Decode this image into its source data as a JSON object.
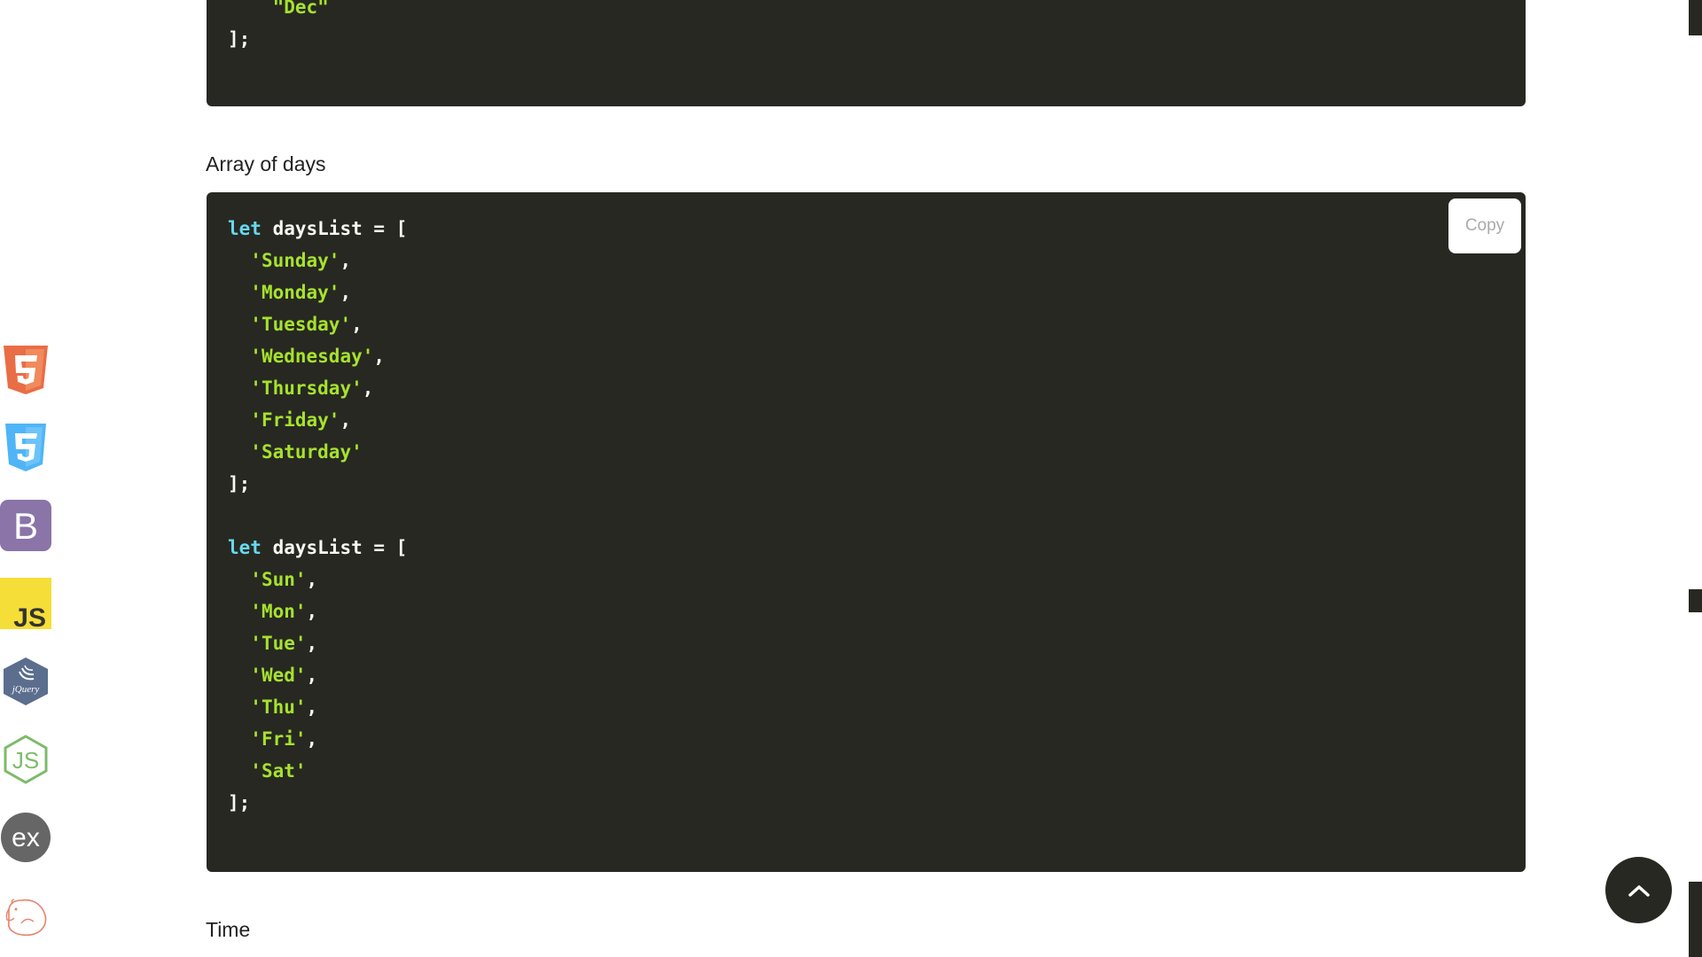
{
  "previous_block": {
    "lines": [
      [
        {
          "t": "    ",
          "c": "punc"
        },
        {
          "t": "\"Dec\"",
          "c": "str"
        }
      ],
      [
        {
          "t": "];",
          "c": "punc"
        }
      ]
    ]
  },
  "sections": {
    "days_label": "Array of days",
    "time_label": "Time"
  },
  "days_block": {
    "copy_label": "Copy",
    "lines": [
      [
        {
          "t": "let",
          "c": "kw"
        },
        {
          "t": " daysList = [",
          "c": "punc"
        }
      ],
      [
        {
          "t": "  ",
          "c": "punc"
        },
        {
          "t": "'Sunday'",
          "c": "str"
        },
        {
          "t": ",",
          "c": "punc"
        }
      ],
      [
        {
          "t": "  ",
          "c": "punc"
        },
        {
          "t": "'Monday'",
          "c": "str"
        },
        {
          "t": ",",
          "c": "punc"
        }
      ],
      [
        {
          "t": "  ",
          "c": "punc"
        },
        {
          "t": "'Tuesday'",
          "c": "str"
        },
        {
          "t": ",",
          "c": "punc"
        }
      ],
      [
        {
          "t": "  ",
          "c": "punc"
        },
        {
          "t": "'Wednesday'",
          "c": "str"
        },
        {
          "t": ",",
          "c": "punc"
        }
      ],
      [
        {
          "t": "  ",
          "c": "punc"
        },
        {
          "t": "'Thursday'",
          "c": "str"
        },
        {
          "t": ",",
          "c": "punc"
        }
      ],
      [
        {
          "t": "  ",
          "c": "punc"
        },
        {
          "t": "'Friday'",
          "c": "str"
        },
        {
          "t": ",",
          "c": "punc"
        }
      ],
      [
        {
          "t": "  ",
          "c": "punc"
        },
        {
          "t": "'Saturday'",
          "c": "str"
        }
      ],
      [
        {
          "t": "];",
          "c": "punc"
        }
      ],
      [
        {
          "t": "",
          "c": "punc"
        }
      ],
      [
        {
          "t": "let",
          "c": "kw"
        },
        {
          "t": " daysList = [",
          "c": "punc"
        }
      ],
      [
        {
          "t": "  ",
          "c": "punc"
        },
        {
          "t": "'Sun'",
          "c": "str"
        },
        {
          "t": ",",
          "c": "punc"
        }
      ],
      [
        {
          "t": "  ",
          "c": "punc"
        },
        {
          "t": "'Mon'",
          "c": "str"
        },
        {
          "t": ",",
          "c": "punc"
        }
      ],
      [
        {
          "t": "  ",
          "c": "punc"
        },
        {
          "t": "'Tue'",
          "c": "str"
        },
        {
          "t": ",",
          "c": "punc"
        }
      ],
      [
        {
          "t": "  ",
          "c": "punc"
        },
        {
          "t": "'Wed'",
          "c": "str"
        },
        {
          "t": ",",
          "c": "punc"
        }
      ],
      [
        {
          "t": "  ",
          "c": "punc"
        },
        {
          "t": "'Thu'",
          "c": "str"
        },
        {
          "t": ",",
          "c": "punc"
        }
      ],
      [
        {
          "t": "  ",
          "c": "punc"
        },
        {
          "t": "'Fri'",
          "c": "str"
        },
        {
          "t": ",",
          "c": "punc"
        }
      ],
      [
        {
          "t": "  ",
          "c": "punc"
        },
        {
          "t": "'Sat'",
          "c": "str"
        }
      ],
      [
        {
          "t": "];",
          "c": "punc"
        }
      ]
    ]
  },
  "sidebar": {
    "icons": [
      {
        "name": "html5-icon",
        "color": "#e96d45"
      },
      {
        "name": "css3-icon",
        "color": "#4fb5f7"
      },
      {
        "name": "bootstrap-icon",
        "color": "#8a74a8",
        "text": "B"
      },
      {
        "name": "javascript-icon",
        "color": "#f5de37",
        "text": "JS"
      },
      {
        "name": "jquery-icon",
        "color": "#5b6e8e",
        "text": "jQuery"
      },
      {
        "name": "nodejs-icon",
        "color": "#7dbb6a",
        "text": "JS"
      },
      {
        "name": "express-icon",
        "color": "#666666",
        "text": "ex"
      },
      {
        "name": "sass-hamster-icon",
        "color": "#e8836b"
      }
    ]
  },
  "scroll_top": {
    "icon": "chevron-up-icon"
  },
  "theme": {
    "code_bg": "#272822",
    "keyword": "#66d9ef",
    "string": "#a6e22e",
    "text": "#f8f8f2"
  }
}
